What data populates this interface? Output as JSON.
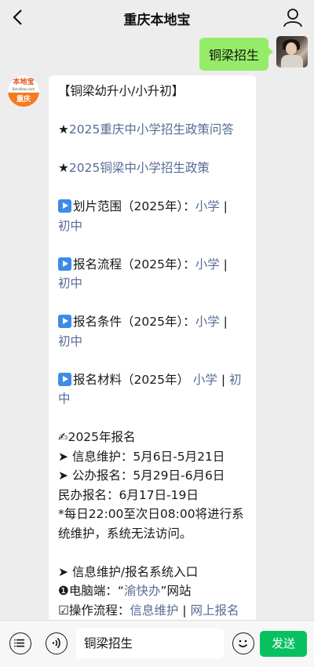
{
  "header": {
    "title": "重庆本地宝"
  },
  "chat": {
    "outgoing": {
      "text": "铜梁招生"
    },
    "bot_avatar": {
      "logo": "本地宝",
      "site": "Bendibao.com",
      "city": "重庆"
    },
    "incoming": {
      "title": "【铜梁幼升小/小升初】",
      "link1": "2025重庆中小学招生政策问答",
      "link2": "2025铜梁中小学招生政策",
      "s1": {
        "label": "划片范围（2025年）：",
        "a": "小学",
        "sep": "|",
        "b": "初中"
      },
      "s2": {
        "label": "报名流程（2025年）：",
        "a": "小学",
        "sep": "|",
        "b": "初中"
      },
      "s3": {
        "label": "报名条件（2025年）：",
        "a": "小学",
        "sep": "|",
        "b": "初中"
      },
      "s4": {
        "label": "报名材料（2025年）",
        "a": "小学",
        "sep": "|",
        "b": "初中"
      },
      "reg_title": "2025年报名",
      "info_maint": "➤ 信息维护：5月6日-5月21日",
      "public_reg": "➤ 公办报名：5月29日-6月6日",
      "private_reg": "民办报名：6月17日-19日",
      "note": "*每日22:00至次日08:00将进行系统维护，系统无法访问。",
      "entry": "➤ 信息维护/报名系统入口",
      "pc_label": "❶电脑端：“",
      "pc_link": "渝快办",
      "pc_tail": "”网站",
      "op_label": "☑操作流程：",
      "op_a": "信息维护",
      "op_sep": "|",
      "op_b": "网上报名"
    }
  },
  "footer": {
    "input_value": "铜梁招生",
    "send_label": "发送"
  },
  "colors": {
    "bubble_out": "#95ec69",
    "link": "#576b95",
    "send": "#07c160",
    "bot": "#f47b20"
  }
}
